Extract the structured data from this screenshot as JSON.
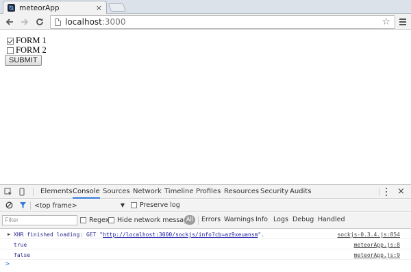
{
  "browser": {
    "tab_title": "meteorApp",
    "tab_close": "×",
    "url_host": "localhost",
    "url_port": ":3000"
  },
  "page": {
    "forms": [
      {
        "label": "FORM 1",
        "checked": true
      },
      {
        "label": "FORM 2",
        "checked": false
      }
    ],
    "submit_label": "SUBMIT"
  },
  "devtools": {
    "tabs": [
      "Elements",
      "Console",
      "Sources",
      "Network",
      "Timeline",
      "Profiles",
      "Resources",
      "Security",
      "Audits"
    ],
    "active_tab": "Console",
    "frame_select": "<top frame>",
    "preserve_log": "Preserve log",
    "filter_placeholder": "Filter",
    "regex": "Regex",
    "hide_network": "Hide network messages",
    "levels": [
      "All",
      "Errors",
      "Warnings",
      "Info",
      "Logs",
      "Debug",
      "Handled"
    ],
    "close": "×",
    "console": [
      {
        "prefix": "XHR finished loading: GET \"",
        "link": "http://localhost:3000/sockjs/info?cb=az9xeuansm",
        "suffix": "\".",
        "source": "sockjs-0.3.4.js:854"
      },
      {
        "text": "true",
        "source": "meteorApp.js:8"
      },
      {
        "text": "false",
        "source": "meteorApp.js:9"
      }
    ],
    "prompt": ">"
  },
  "colors": {
    "tab_strip": "#dbe2ea",
    "active_devtools_tab": "#3879d9",
    "console_text": "#2a2a8c"
  }
}
